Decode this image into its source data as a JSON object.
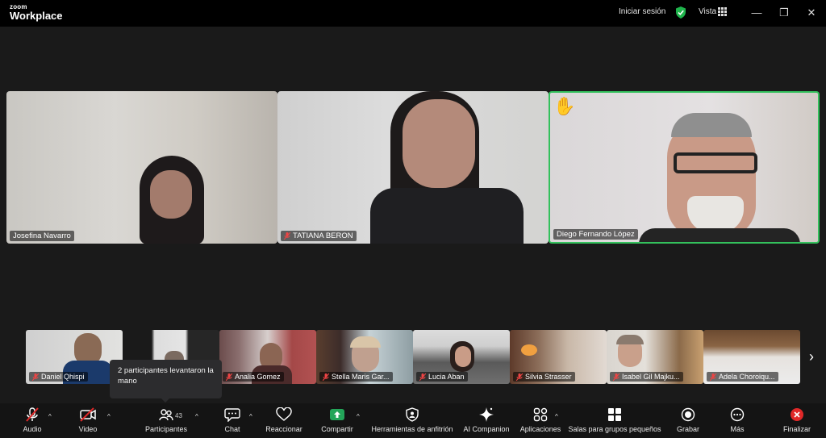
{
  "titlebar": {
    "logo_small": "zoom",
    "logo_big": "Workplace",
    "signin": "Iniciar sesión",
    "view": "Vista",
    "minimize": "—",
    "restore": "❐",
    "close": "✕"
  },
  "main_tiles": [
    {
      "name": "Josefina Navarro",
      "muted": false
    },
    {
      "name": "TATIANA BERON",
      "muted": true
    },
    {
      "name": "Diego Fernando López",
      "muted": false,
      "hand_raised": true,
      "active_speaker": true
    }
  ],
  "strip_tiles": [
    {
      "name": "Daniel Qhispi",
      "muted": true
    },
    {
      "name": "",
      "muted": false
    },
    {
      "name": "Analia Gomez",
      "muted": true
    },
    {
      "name": "Stella Maris Gar...",
      "muted": true
    },
    {
      "name": "Lucia Aban",
      "muted": true
    },
    {
      "name": "Silvia Strasser",
      "muted": true
    },
    {
      "name": "Isabel Gil Majku...",
      "muted": true
    },
    {
      "name": "Adela Choroiqu...",
      "muted": true
    }
  ],
  "hand_emoji": "✋",
  "next_arrow": "›",
  "tooltip": "2 participantes levantaron la mano",
  "toolbar": {
    "audio": "Audio",
    "video": "Video",
    "participants": "Participantes",
    "participants_count": "43",
    "chat": "Chat",
    "react": "Reaccionar",
    "share": "Compartir",
    "host_tools": "Herramientas de anfitrión",
    "ai": "AI Companion",
    "apps": "Aplicaciones",
    "rooms": "Salas para grupos pequeños",
    "record": "Grabar",
    "more": "Más",
    "end": "Finalizar",
    "caret": "^"
  },
  "colors": {
    "speaker_border": "#33c15c",
    "share_green": "#23a559",
    "end_red": "#e02828"
  }
}
